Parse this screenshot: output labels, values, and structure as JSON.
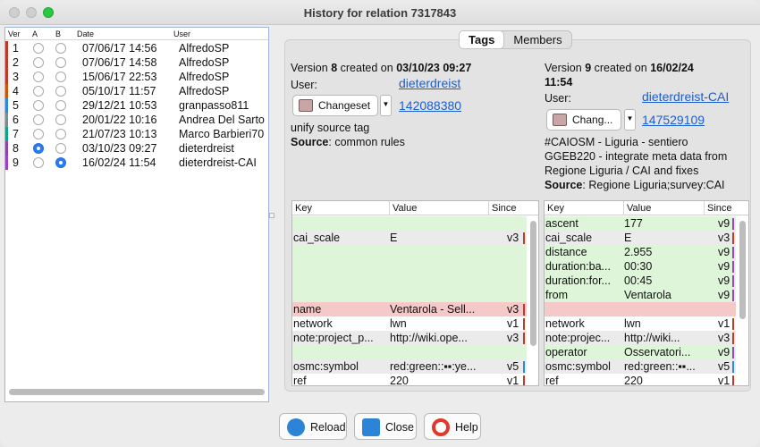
{
  "window": {
    "title": "History for relation 7317843"
  },
  "history": {
    "headers": {
      "ver": "Ver",
      "a": "A",
      "b": "B",
      "date": "Date",
      "user": "User"
    },
    "rows": [
      {
        "ver": "1",
        "date": "07/06/17 14:56",
        "user": "AlfredoSP",
        "a": false,
        "b": false,
        "color": "#c0392b"
      },
      {
        "ver": "2",
        "date": "07/06/17 14:58",
        "user": "AlfredoSP",
        "a": false,
        "b": false,
        "color": "#c0392b"
      },
      {
        "ver": "3",
        "date": "15/06/17 22:53",
        "user": "AlfredoSP",
        "a": false,
        "b": false,
        "color": "#c0392b"
      },
      {
        "ver": "4",
        "date": "05/10/17 11:57",
        "user": "AlfredoSP",
        "a": false,
        "b": false,
        "color": "#d35400"
      },
      {
        "ver": "5",
        "date": "29/12/21 10:53",
        "user": "granpasso811",
        "a": false,
        "b": false,
        "color": "#2e86de"
      },
      {
        "ver": "6",
        "date": "20/01/22 10:16",
        "user": "Andrea Del Sarto",
        "a": false,
        "b": false,
        "color": "#7f8c8d"
      },
      {
        "ver": "7",
        "date": "21/07/23 10:13",
        "user": "Marco Barbieri70",
        "a": false,
        "b": false,
        "color": "#16a085"
      },
      {
        "ver": "8",
        "date": "03/10/23 09:27",
        "user": "dieterdreist",
        "a": true,
        "b": false,
        "color": "#8e44ad"
      },
      {
        "ver": "9",
        "date": "16/02/24 11:54",
        "user": "dieterdreist-CAI",
        "a": false,
        "b": true,
        "color": "#9b3fd1"
      }
    ]
  },
  "tabs": {
    "tags": "Tags",
    "members": "Members"
  },
  "left_version": {
    "version_prefix": "Version",
    "version": "8",
    "created_on": "created on",
    "date": "03/10/23 09:27",
    "user_label": "User:",
    "user": "dieterdreist",
    "changeset_label": "Changeset",
    "changeset_id": "142088380",
    "comment": "unify source tag",
    "source_label": "Source",
    "source": "common rules"
  },
  "right_version": {
    "version_prefix": "Version",
    "version": "9",
    "created_on": "created on",
    "date": "16/02/24",
    "time": "11:54",
    "user_label": "User:",
    "user": "dieterdreist-CAI",
    "changeset_label": "Chang...",
    "changeset_id": "147529109",
    "comment_1": "#CAIOSM - Liguria - sentiero",
    "comment_2": "GGEB220 - integrate meta data from",
    "comment_3": "Regione Liguria / CAI and fixes",
    "source_label": "Source",
    "source": "Regione Liguria;survey:CAI"
  },
  "table_headers": {
    "key": "Key",
    "value": "Value",
    "since": "Since"
  },
  "left_tags": [
    {
      "key": "",
      "value": "",
      "since": "",
      "bg": "#dff5da",
      "mark": ""
    },
    {
      "key": "cai_scale",
      "value": "E",
      "since": "v3",
      "bg": "#ebebeb",
      "mark": "#c0392b"
    },
    {
      "key": "",
      "value": "",
      "since": "",
      "bg": "#dff5da",
      "mark": ""
    },
    {
      "key": "",
      "value": "",
      "since": "",
      "bg": "#dff5da",
      "mark": ""
    },
    {
      "key": "",
      "value": "",
      "since": "",
      "bg": "#dff5da",
      "mark": ""
    },
    {
      "key": "",
      "value": "",
      "since": "",
      "bg": "#dff5da",
      "mark": ""
    },
    {
      "key": "name",
      "value": "Ventarola - Sell...",
      "since": "v3",
      "bg": "#f6c9c9",
      "mark": "#c0392b"
    },
    {
      "key": "network",
      "value": "lwn",
      "since": "v1",
      "bg": "#fff",
      "mark": "#c0392b"
    },
    {
      "key": "note:project_p...",
      "value": "http://wiki.ope...",
      "since": "v3",
      "bg": "#ebebeb",
      "mark": "#c0392b"
    },
    {
      "key": "",
      "value": "",
      "since": "",
      "bg": "#dff5da",
      "mark": ""
    },
    {
      "key": "osmc:symbol",
      "value": "red:green::▪▪:ye...",
      "since": "v5",
      "bg": "#ebebeb",
      "mark": "#2e86de"
    },
    {
      "key": "ref",
      "value": "220",
      "since": "v1",
      "bg": "#fff",
      "mark": "#c0392b"
    }
  ],
  "right_tags": [
    {
      "key": "ascent",
      "value": "177",
      "since": "v9",
      "bg": "#dff5da",
      "mark": "#9b3fd1"
    },
    {
      "key": "cai_scale",
      "value": "E",
      "since": "v3",
      "bg": "#ebebeb",
      "mark": "#c0392b"
    },
    {
      "key": "distance",
      "value": "2.955",
      "since": "v9",
      "bg": "#dff5da",
      "mark": "#9b3fd1"
    },
    {
      "key": "duration:ba...",
      "value": "00:30",
      "since": "v9",
      "bg": "#dff5da",
      "mark": "#9b3fd1"
    },
    {
      "key": "duration:for...",
      "value": "00:45",
      "since": "v9",
      "bg": "#dff5da",
      "mark": "#9b3fd1"
    },
    {
      "key": "from",
      "value": "Ventarola",
      "since": "v9",
      "bg": "#dff5da",
      "mark": "#9b3fd1"
    },
    {
      "key": "",
      "value": "",
      "since": "",
      "bg": "#f6c9c9",
      "mark": ""
    },
    {
      "key": "network",
      "value": "lwn",
      "since": "v1",
      "bg": "#fff",
      "mark": "#c0392b"
    },
    {
      "key": "note:projec...",
      "value": "http://wiki...",
      "since": "v3",
      "bg": "#ebebeb",
      "mark": "#c0392b"
    },
    {
      "key": "operator",
      "value": "Osservatori...",
      "since": "v9",
      "bg": "#dff5da",
      "mark": "#9b3fd1"
    },
    {
      "key": "osmc:symbol",
      "value": "red:green::▪▪...",
      "since": "v5",
      "bg": "#ebebeb",
      "mark": "#2e86de"
    },
    {
      "key": "ref",
      "value": "220",
      "since": "v1",
      "bg": "#fff",
      "mark": "#c0392b"
    }
  ],
  "buttons": {
    "reload": "Reload",
    "close": "Close",
    "help": "Help"
  },
  "icons": {
    "reload": "refresh-icon",
    "close": "arrow-left-icon",
    "help": "lifebuoy-icon",
    "changeset": "changeset-icon"
  }
}
